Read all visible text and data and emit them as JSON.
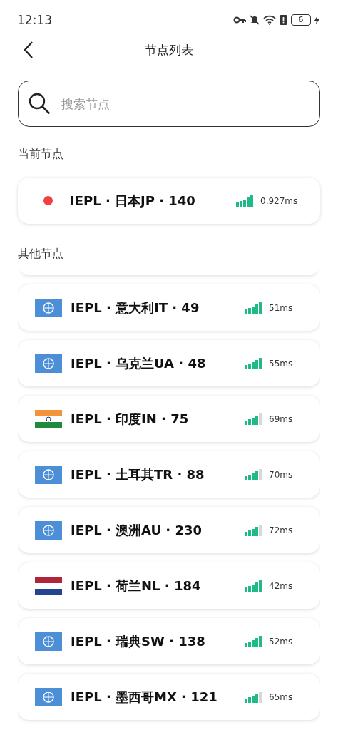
{
  "status_bar": {
    "time": "12:13",
    "battery": "6"
  },
  "header": {
    "title": "节点列表"
  },
  "search": {
    "placeholder": "搜索节点"
  },
  "current_section": {
    "title": "当前节点",
    "node": {
      "name": "IEPL · 日本JP · 140",
      "latency": "0.927ms",
      "full_signal": true,
      "color": "#f04040"
    }
  },
  "other_section": {
    "title": "其他节点",
    "nodes": [
      {
        "name": "IEPL · 意大利IT · 49",
        "latency": "51ms",
        "full_signal": true,
        "kind": "un"
      },
      {
        "name": "IEPL · 乌克兰UA · 48",
        "latency": "55ms",
        "full_signal": true,
        "kind": "un"
      },
      {
        "name": "IEPL · 印度IN · 75",
        "latency": "69ms",
        "full_signal": false,
        "kind": "india"
      },
      {
        "name": "IEPL · 土耳其TR · 88",
        "latency": "70ms",
        "full_signal": false,
        "kind": "un"
      },
      {
        "name": "IEPL · 澳洲AU · 230",
        "latency": "72ms",
        "full_signal": false,
        "kind": "un"
      },
      {
        "name": "IEPL · 荷兰NL · 184",
        "latency": "42ms",
        "full_signal": true,
        "kind": "netherlands"
      },
      {
        "name": "IEPL · 瑞典SW · 138",
        "latency": "52ms",
        "full_signal": true,
        "kind": "un"
      },
      {
        "name": "IEPL · 墨西哥MX · 121",
        "latency": "65ms",
        "full_signal": false,
        "kind": "un"
      }
    ]
  }
}
